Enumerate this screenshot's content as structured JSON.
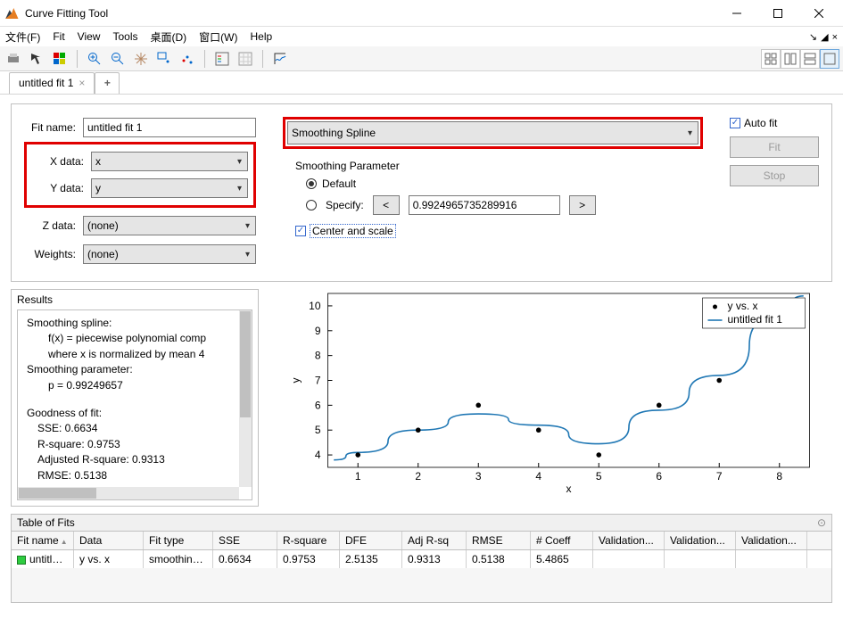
{
  "window": {
    "title": "Curve Fitting Tool"
  },
  "menu": {
    "file": "文件(F)",
    "fit": "Fit",
    "view": "View",
    "tools": "Tools",
    "desktop": "桌面(D)",
    "window": "窗口(W)",
    "help": "Help"
  },
  "tabs": {
    "tab1": "untitled fit 1",
    "close": "×",
    "add": "+"
  },
  "left": {
    "fitname_label": "Fit name:",
    "fitname_value": "untitled fit 1",
    "xdata_label": "X data:",
    "xdata_value": "x",
    "ydata_label": "Y data:",
    "ydata_value": "y",
    "zdata_label": "Z data:",
    "zdata_value": "(none)",
    "weights_label": "Weights:",
    "weights_value": "(none)"
  },
  "mid": {
    "fit_type": "Smoothing Spline",
    "param_title": "Smoothing Parameter",
    "default": "Default",
    "specify": "Specify:",
    "lt": "<",
    "gt": ">",
    "p_value": "0.9924965735289916",
    "center_scale": "Center and scale"
  },
  "right": {
    "auto_fit": "Auto fit",
    "fit_btn": "Fit",
    "stop_btn": "Stop"
  },
  "results": {
    "title": "Results",
    "l1": "Smoothing spline:",
    "l2": "f(x) = piecewise polynomial comp",
    "l3": "where x is normalized by mean 4",
    "l4": "Smoothing parameter:",
    "l5": "p = 0.99249657",
    "l6": "Goodness of fit:",
    "l7": "SSE: 0.6634",
    "l8": "R-square: 0.9753",
    "l9": "Adjusted R-square: 0.9313",
    "l10": "RMSE: 0.5138"
  },
  "plot": {
    "ylabel": "y",
    "xlabel": "x",
    "legend1": "y vs. x",
    "legend2": "untitled fit 1"
  },
  "chart_data": {
    "type": "scatter+line",
    "title": "",
    "xlabel": "x",
    "ylabel": "y",
    "xlim": [
      0.5,
      8.5
    ],
    "ylim": [
      3.5,
      10.5
    ],
    "xticks": [
      1,
      2,
      3,
      4,
      5,
      6,
      7,
      8
    ],
    "yticks": [
      4,
      5,
      6,
      7,
      8,
      9,
      10
    ],
    "series": [
      {
        "name": "y vs. x",
        "kind": "scatter",
        "x": [
          1,
          2,
          3,
          4,
          5,
          6,
          7,
          8
        ],
        "y": [
          4,
          5,
          6,
          5,
          4,
          6,
          7,
          10
        ]
      },
      {
        "name": "untitled fit 1",
        "kind": "line",
        "x": [
          0.6,
          1,
          2,
          3,
          4,
          5,
          6,
          7,
          8,
          8.4
        ],
        "y": [
          3.8,
          4.1,
          5.0,
          5.65,
          5.2,
          4.45,
          5.8,
          7.2,
          9.6,
          10.4
        ]
      }
    ]
  },
  "table": {
    "title": "Table of Fits",
    "headers": [
      "Fit name",
      "Data",
      "Fit type",
      "SSE",
      "R-square",
      "DFE",
      "Adj R-sq",
      "RMSE",
      "# Coeff",
      "Validation...",
      "Validation...",
      "Validation..."
    ],
    "row": [
      "untitled ...",
      "y vs. x",
      "smoothing...",
      "0.6634",
      "0.9753",
      "2.5135",
      "0.9313",
      "0.5138",
      "5.4865",
      "",
      "",
      ""
    ]
  }
}
